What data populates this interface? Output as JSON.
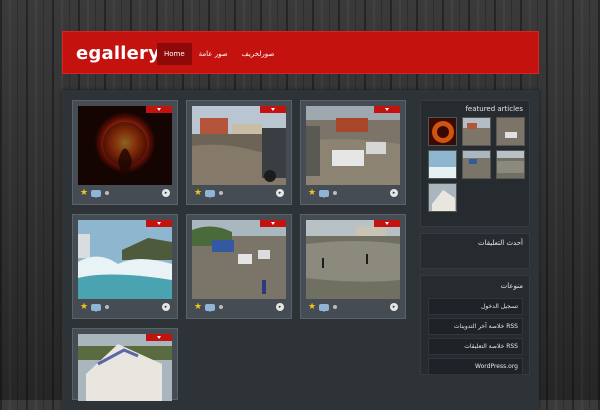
{
  "header": {
    "logo": "egallery",
    "nav": [
      "Home",
      "صور عامة",
      "صورلخريف"
    ]
  },
  "gallery": {
    "thumbnails": [
      {
        "name": "fire-globe-photo"
      },
      {
        "name": "flooded-street-photo"
      },
      {
        "name": "flooded-trucks-photo"
      },
      {
        "name": "waves-photo"
      },
      {
        "name": "flooded-road-cars-photo"
      },
      {
        "name": "flooded-field-photo"
      },
      {
        "name": "tent-photo"
      }
    ]
  },
  "sidebar": {
    "featured_title": "featured articles",
    "comments_title": "أحدث التعليقات",
    "misc_title": "منوعات",
    "misc_links": [
      "تسجيل الدخول",
      "خلاصة آخر التدوينات RSS",
      "خلاصة التعليقات RSS",
      "WordPress.org"
    ]
  },
  "colors": {
    "accent": "#c4120e",
    "panel": "#2e3338",
    "tile": "#464c53"
  },
  "icons": {
    "rating": "star-icon",
    "comments": "comment-bubble-icon",
    "more": "arrow-right-icon"
  }
}
